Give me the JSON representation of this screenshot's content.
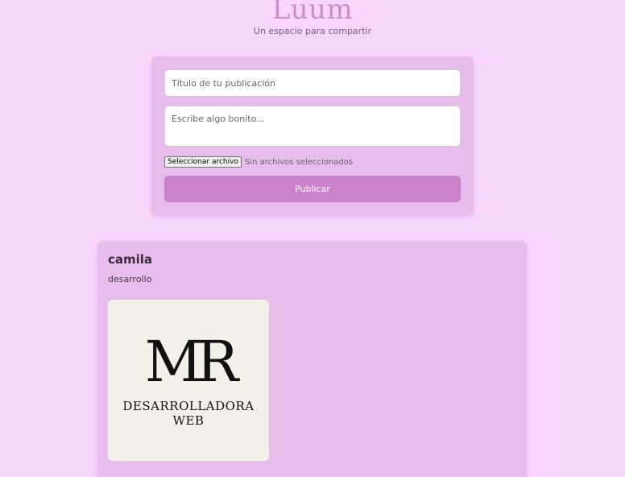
{
  "header": {
    "brand": "Luum",
    "tagline": "Un espacio para compartir"
  },
  "form": {
    "title_placeholder": "Título de tu publicación",
    "body_placeholder": "Escribe algo bonito...",
    "file_button_label": "Seleccionar archivo",
    "file_status": "Sin archivos seleccionados",
    "publish_label": "Publicar"
  },
  "post": {
    "author": "camila",
    "text": "desarrollo",
    "image_logo": {
      "monogram": "MR",
      "line1": "DESARROLLADORA",
      "line2": "WEB"
    }
  },
  "colors": {
    "background": "#f8d5fc",
    "card": "#e6bdea",
    "accent": "#cb82cb",
    "brand": "#c88fc8"
  }
}
